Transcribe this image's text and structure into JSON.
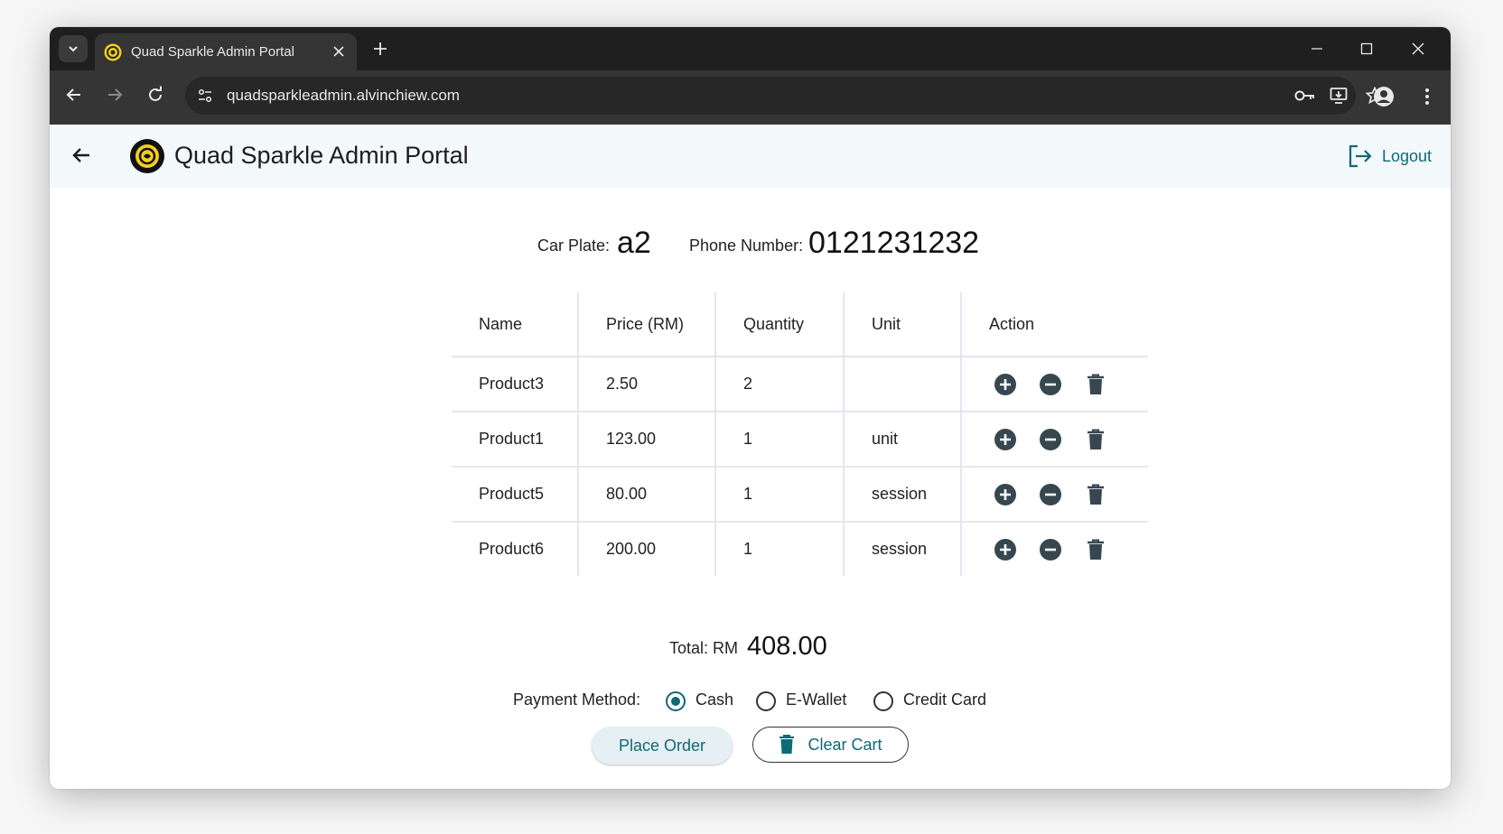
{
  "browser": {
    "tab_title": "Quad Sparkle Admin Portal",
    "url": "quadsparkleadmin.alvinchiew.com"
  },
  "header": {
    "title": "Quad Sparkle Admin Portal",
    "logout_label": "Logout"
  },
  "order_info": {
    "car_plate_label": "Car Plate:",
    "car_plate_value": "a2",
    "phone_label": "Phone Number:",
    "phone_value": "0121231232"
  },
  "cart_table": {
    "columns": [
      "Name",
      "Price (RM)",
      "Quantity",
      "Unit",
      "Action"
    ],
    "rows": [
      {
        "name": "Product3",
        "price": "2.50",
        "quantity": "2",
        "unit": ""
      },
      {
        "name": "Product1",
        "price": "123.00",
        "quantity": "1",
        "unit": "unit"
      },
      {
        "name": "Product5",
        "price": "80.00",
        "quantity": "1",
        "unit": "session"
      },
      {
        "name": "Product6",
        "price": "200.00",
        "quantity": "1",
        "unit": "session"
      }
    ]
  },
  "total": {
    "label": "Total: RM",
    "value": "408.00"
  },
  "payment": {
    "label": "Payment Method:",
    "options": [
      "Cash",
      "E-Wallet",
      "Credit Card"
    ],
    "selected": "Cash"
  },
  "actions": {
    "place_order": "Place Order",
    "clear_cart": "Clear Cart"
  },
  "colors": {
    "accent": "#0e6a75",
    "header_bg": "#f3f8fb",
    "icon": "#37474f"
  }
}
